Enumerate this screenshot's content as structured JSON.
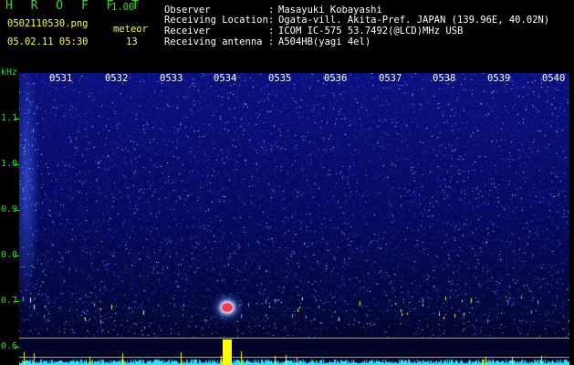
{
  "header": {
    "app_title": "H R O F F T",
    "version": "1.00",
    "file_name": "0502110530.png",
    "meteor_label": "meteor",
    "date_time": "05.02.11 05:30",
    "meteor_count": "13"
  },
  "info": [
    {
      "key": "Observer",
      "value": "Masayuki Kobayashi"
    },
    {
      "key": "Receiving Location",
      "value": "Ogata-vill. Akita-Pref. JAPAN (139.96E, 40.02N)"
    },
    {
      "key": "Receiver",
      "value": "ICOM IC-575 53.7492(@LCD)MHz USB"
    },
    {
      "key": "Receiving antenna",
      "value": "A504HB(yagi 4el)"
    }
  ],
  "axis": {
    "unit": "kHz",
    "time_labels": [
      "0531",
      "0532",
      "0533",
      "0534",
      "0535",
      "0536",
      "0537",
      "0538",
      "0539",
      "0540"
    ],
    "freq_labels": [
      "1.1",
      "1.0",
      "0.9",
      "0.8",
      "0.7",
      "0.6"
    ]
  },
  "colors": {
    "header_green": "#2fdc2f",
    "accent_yellow": "#ffff33",
    "meteor_red": "#ff3850",
    "baseline_cyan": "#30e0ff"
  }
}
